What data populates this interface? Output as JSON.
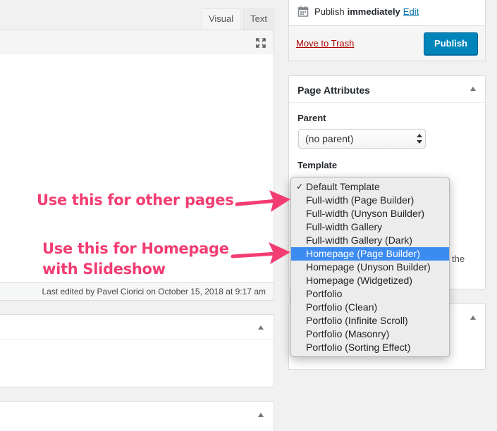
{
  "editor": {
    "tabs": [
      {
        "label": "Visual"
      },
      {
        "label": "Text"
      }
    ],
    "status_text": "Last edited by Pavel Ciorici on October 15, 2018 at 9:17 am"
  },
  "publish": {
    "publish_label": "Publish",
    "publish_when": "immediately",
    "edit_link": "Edit",
    "trash_link": "Move to Trash",
    "publish_button": "Publish"
  },
  "page_attributes": {
    "title": "Page Attributes",
    "parent_label": "Parent",
    "parent_value": "(no parent)",
    "template_label": "Template",
    "partial_text": "the"
  },
  "template_dropdown": {
    "options": [
      {
        "label": "Default Template"
      },
      {
        "label": "Full-width (Page Builder)"
      },
      {
        "label": "Full-width (Unyson Builder)"
      },
      {
        "label": "Full-width Gallery"
      },
      {
        "label": "Full-width Gallery (Dark)"
      },
      {
        "label": "Homepage (Page Builder)"
      },
      {
        "label": "Homepage (Unyson Builder)"
      },
      {
        "label": "Homepage (Widgetized)"
      },
      {
        "label": "Portfolio"
      },
      {
        "label": "Portfolio (Clean)"
      },
      {
        "label": "Portfolio (Infinite Scroll)"
      },
      {
        "label": "Portfolio (Masonry)"
      },
      {
        "label": "Portfolio (Sorting Effect)"
      }
    ],
    "checked_option": "Default Template",
    "highlighted_option": "Homepage (Page Builder)"
  },
  "annotations": {
    "note_other_pages": "Use this for other pages",
    "note_homepage_line1": "Use this for Homepage",
    "note_homepage_line2": "with Slideshow",
    "color": "#f33d72"
  },
  "colors": {
    "accent": "#0085ba",
    "trash": "#aa0000",
    "highlight": "#3b8bf0"
  },
  "icons": [
    "fullscreen-icon",
    "calendar-icon",
    "collapse-arrow-icon",
    "select-updown-icon",
    "checkmark-icon",
    "arrow-icon"
  ]
}
